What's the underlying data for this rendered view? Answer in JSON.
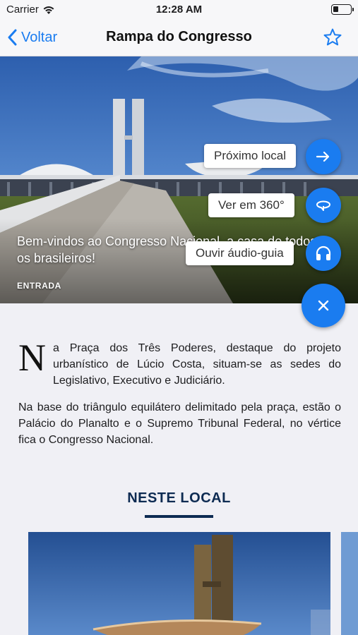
{
  "status_bar": {
    "carrier": "Carrier",
    "time": "12:28 AM"
  },
  "nav": {
    "back_label": "Voltar",
    "title": "Rampa do Congresso"
  },
  "hero": {
    "caption": "Bem-vindos ao Congresso Nacional, a casa de todos os brasileiros!",
    "tag": "ENTRADA"
  },
  "speed_dial": {
    "next_label": "Próximo local",
    "view360_label": "Ver em 360°",
    "audio_label": "Ouvir áudio-guia"
  },
  "content": {
    "dropcap": "N",
    "paragraph1": "a Praça dos Três Poderes, destaque do projeto urbanístico de Lúcio Costa, situam-se as sedes do Legislativo, Executivo e Judiciário.",
    "paragraph2": "Na base do triângulo equilátero delimitado pela praça, estão o Palácio do Planalto e o Supremo Tribunal Federal, no vértice fica o Congresso Nacional."
  },
  "section": {
    "title": "NESTE LOCAL"
  },
  "colors": {
    "accent": "#1a7cf0",
    "section_title": "#0d2b52",
    "background": "#f0f0f5"
  }
}
